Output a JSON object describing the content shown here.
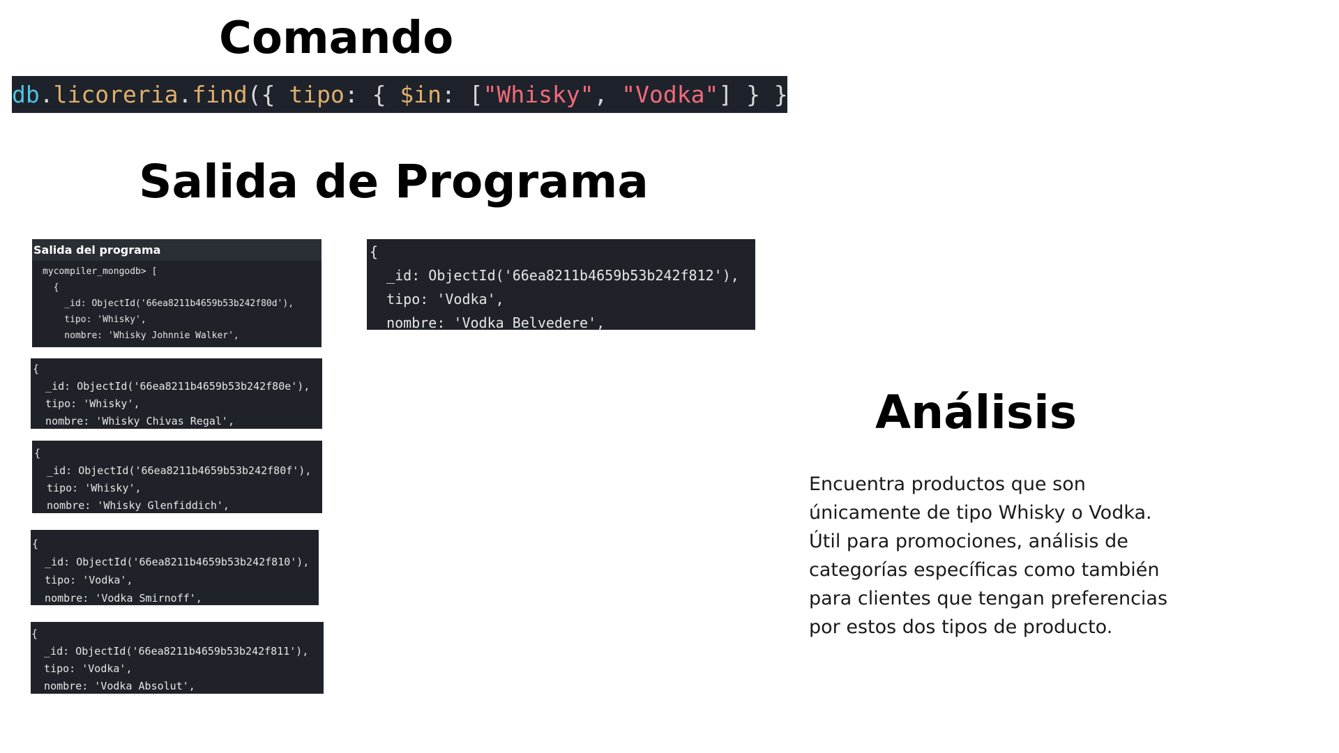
{
  "headings": {
    "comando": "Comando",
    "salida": "Salida de Programa",
    "analisis": "Análisis"
  },
  "command": {
    "obj": "db",
    "dot1": ".",
    "coll": "licoreria",
    "dot2": ".",
    "method": "find",
    "open": "({ ",
    "key": "tipo",
    "colon": ": { ",
    "op": "$in",
    "colon2": ": [",
    "s1": "\"Whisky\"",
    "comma": ", ",
    "s2": "\"Vodka\"",
    "close": "] } })"
  },
  "panels": {
    "p1": {
      "header": "Salida del programa",
      "lines": [
        "mycompiler_mongodb> [",
        "  {",
        "    _id: ObjectId('66ea8211b4659b53b242f80d'),",
        "    tipo: 'Whisky',",
        "    nombre: 'Whisky Johnnie Walker',"
      ]
    },
    "p2": {
      "lines": [
        "{",
        "  _id: ObjectId('66ea8211b4659b53b242f80e'),",
        "  tipo: 'Whisky',",
        "  nombre: 'Whisky Chivas Regal',"
      ]
    },
    "p3": {
      "lines": [
        "{",
        "  _id: ObjectId('66ea8211b4659b53b242f80f'),",
        "  tipo: 'Whisky',",
        "  nombre: 'Whisky Glenfiddich',"
      ]
    },
    "p4": {
      "lines": [
        "{",
        "  _id: ObjectId('66ea8211b4659b53b242f810'),",
        "  tipo: 'Vodka',",
        "  nombre: 'Vodka Smirnoff',"
      ]
    },
    "p5": {
      "lines": [
        "{",
        "  _id: ObjectId('66ea8211b4659b53b242f811'),",
        "  tipo: 'Vodka',",
        "  nombre: 'Vodka Absolut',"
      ]
    },
    "p6": {
      "lines": [
        "{",
        "  _id: ObjectId('66ea8211b4659b53b242f812'),",
        "  tipo: 'Vodka',",
        "  nombre: 'Vodka Belvedere',"
      ]
    }
  },
  "analysis_text": "Encuentra productos que son únicamente de tipo Whisky o Vodka. Útil para promociones, análisis de categorías específicas como también para clientes que tengan preferencias por estos dos tipos de producto.",
  "colors": {
    "panel_bg": "#1f2329",
    "command_bg": "#1e222b",
    "string": "#f06c7a",
    "keyword": "#e0b06c",
    "object": "#4fc3e0"
  }
}
